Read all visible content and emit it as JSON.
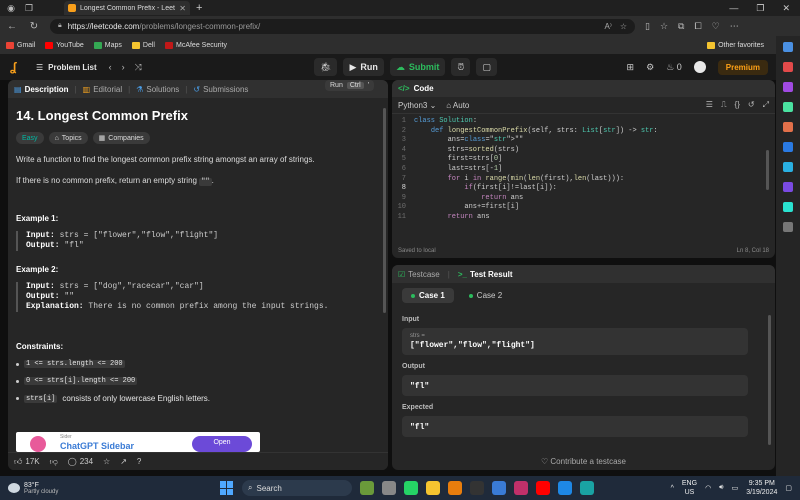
{
  "browser": {
    "tab_title": "Longest Common Prefix - LeetCode",
    "url_host": "https://leetcode.com",
    "url_path": "/problems/longest-common-prefix/"
  },
  "bookmarks": {
    "items": [
      {
        "label": "Gmail",
        "color": "#ea4335"
      },
      {
        "label": "YouTube",
        "color": "#ff0000"
      },
      {
        "label": "Maps",
        "color": "#34a853"
      },
      {
        "label": "Dell",
        "color": "#f4c430"
      },
      {
        "label": "McAfee Security",
        "color": "#c01818"
      }
    ],
    "other_favorites": "Other favorites"
  },
  "header": {
    "problem_list": "Problem List",
    "run": "Run",
    "submit": "Submit",
    "fire_count": "0",
    "premium": "Premium"
  },
  "left": {
    "tabs": [
      "Description",
      "Editorial",
      "Solutions",
      "Submissions"
    ],
    "run_tip": {
      "label": "Run",
      "key": "Ctrl"
    },
    "title": "14. Longest Common Prefix",
    "tags": [
      "Easy",
      "Topics",
      "Companies"
    ],
    "description": "Write a function to find the longest common prefix string amongst an array of strings.",
    "no_prefix_before": "If there is no common prefix, return an empty string",
    "no_prefix_code": "\"\"",
    "no_prefix_after": ".",
    "example1": {
      "heading": "Example 1:",
      "input_label": "Input:",
      "input": "strs = [\"flower\",\"flow\",\"flight\"]",
      "output_label": "Output:",
      "output": "\"fl\""
    },
    "example2": {
      "heading": "Example 2:",
      "input_label": "Input:",
      "input": "strs = [\"dog\",\"racecar\",\"car\"]",
      "output_label": "Output:",
      "output": "\"\"",
      "explanation_label": "Explanation:",
      "explanation": "There is no common prefix among the input strings."
    },
    "constraints_heading": "Constraints:",
    "constraints": [
      {
        "code": "1 <= strs.length <= 200",
        "text": ""
      },
      {
        "code": "0 <= strs[i].length <= 200",
        "text": ""
      },
      {
        "code": "strs[i]",
        "text": "consists of only lowercase English letters."
      }
    ],
    "ad": {
      "sub": "Sider",
      "main": "ChatGPT Sidebar",
      "open": "Open"
    },
    "footer": {
      "likes": "17K",
      "comments": "234"
    }
  },
  "code": {
    "header": "Code",
    "language": "Python3",
    "auto": "Auto",
    "saved": "Saved to local",
    "position": "Ln 8, Col 18",
    "lines": [
      "class Solution:",
      "    def longestCommonPrefix(self, strs: List[str]) -> str:",
      "        ans=\"\"",
      "        strs=sorted(strs)",
      "        first=strs[0]",
      "        last=strs[-1]",
      "        for i in range(min(len(first),len(last))):",
      "            if(first[i]!=last[i]):",
      "                return ans",
      "            ans+=first[i]",
      "        return ans"
    ],
    "current_line": 8
  },
  "tests": {
    "tabs": [
      "Testcase",
      "Test Result"
    ],
    "cases": [
      "Case 1",
      "Case 2"
    ],
    "input_label": "Input",
    "input_var": "strs =",
    "input_value": "[\"flower\",\"flow\",\"flight\"]",
    "output_label": "Output",
    "output_value": "\"fl\"",
    "expected_label": "Expected",
    "expected_value": "\"fl\"",
    "contribute": "Contribute a testcase"
  },
  "taskbar": {
    "temp": "83°F",
    "weather": "Partly cloudy",
    "search": "Search",
    "lang_top": "ENG",
    "lang_bottom": "US",
    "time": "9:35 PM",
    "date": "3/19/2024"
  }
}
